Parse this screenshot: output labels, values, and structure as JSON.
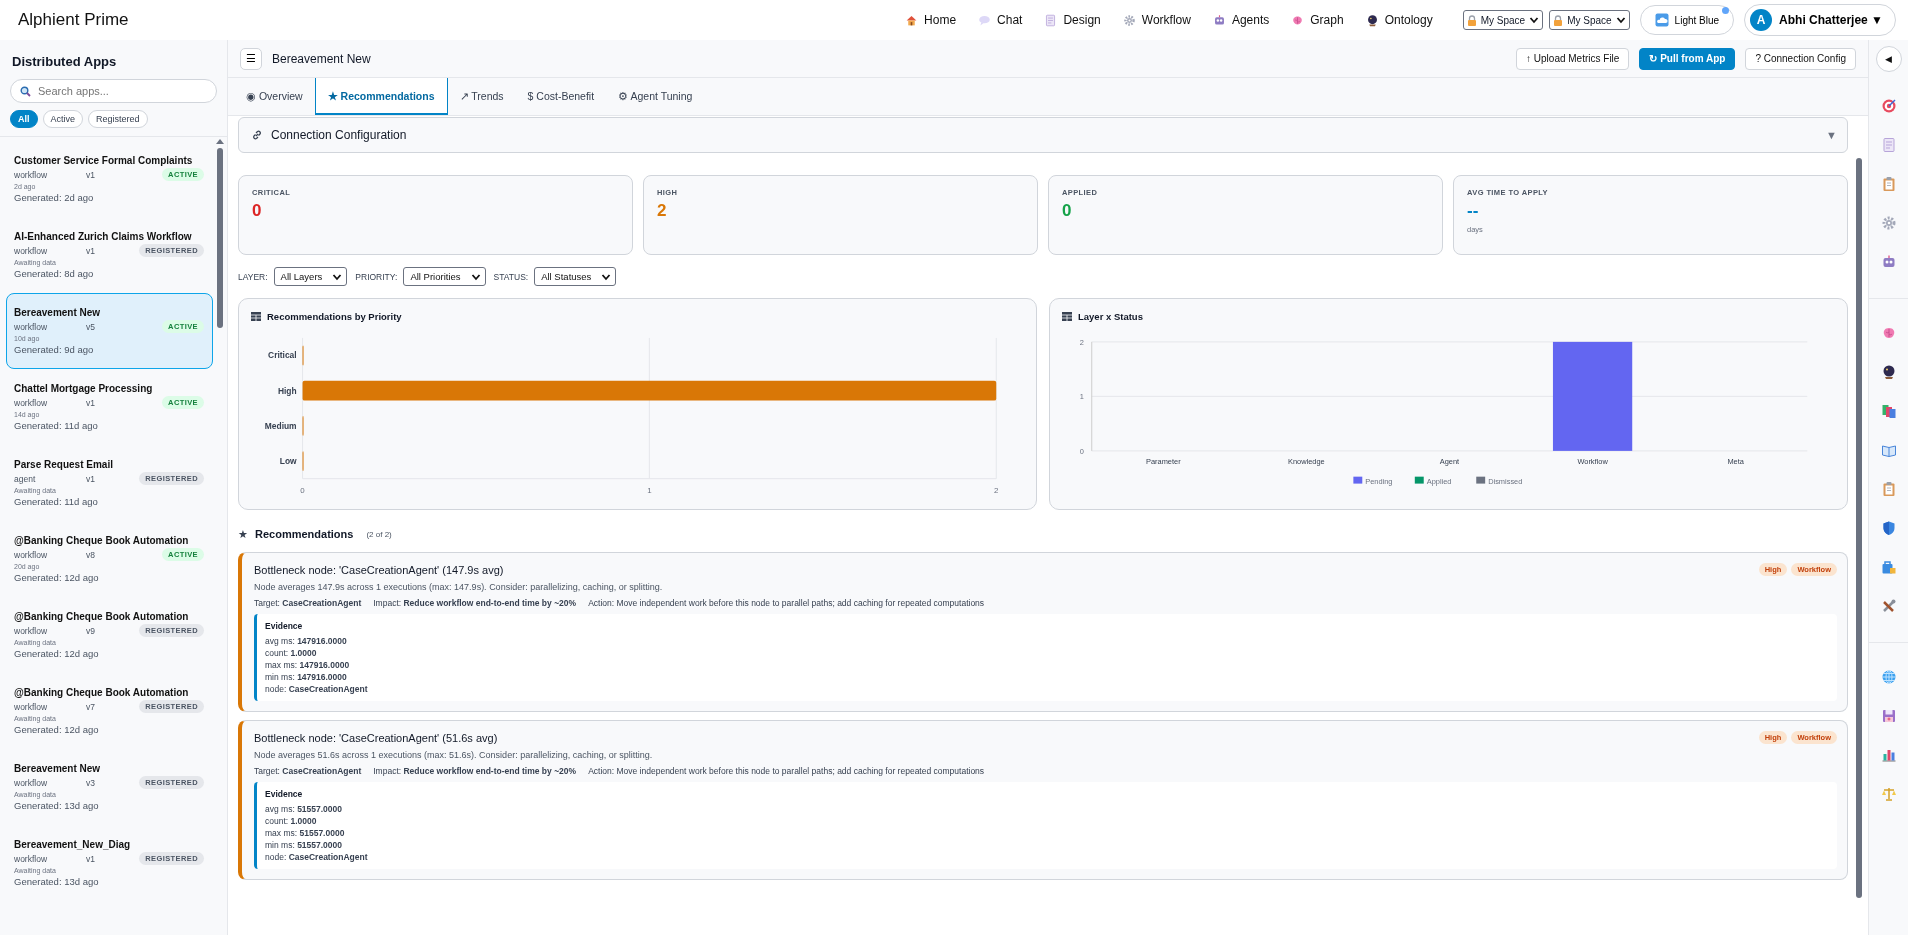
{
  "app": {
    "title": "Alphient Prime"
  },
  "nav": [
    {
      "label": "Home"
    },
    {
      "label": "Chat"
    },
    {
      "label": "Design"
    },
    {
      "label": "Workflow"
    },
    {
      "label": "Agents"
    },
    {
      "label": "Graph"
    },
    {
      "label": "Ontology"
    }
  ],
  "space_selects": [
    {
      "value": "My Space"
    },
    {
      "value": "My Space"
    }
  ],
  "theme_button": {
    "label": "Light Blue"
  },
  "user": {
    "initial": "A",
    "name": "Abhi Chatterjee",
    "caret": "▼"
  },
  "sidebar": {
    "title": "Distributed Apps",
    "search": {
      "placeholder": "Search apps..."
    },
    "filters": [
      {
        "label": "All",
        "selected": true
      },
      {
        "label": "Active",
        "selected": false
      },
      {
        "label": "Registered",
        "selected": false
      }
    ],
    "apps": [
      {
        "name": "Customer Service Formal Complaints",
        "type": "workflow",
        "version": "v1",
        "status": "ACTIVE",
        "kind": "active",
        "age": "2d ago",
        "generated": "Generated: 2d ago",
        "selected": false
      },
      {
        "name": "AI-Enhanced Zurich Claims Workflow",
        "type": "workflow",
        "version": "v1",
        "status": "REGISTERED",
        "kind": "registered",
        "age": "Awaiting data",
        "generated": "Generated: 8d ago",
        "selected": false
      },
      {
        "name": "Bereavement New",
        "type": "workflow",
        "version": "v5",
        "status": "ACTIVE",
        "kind": "active",
        "age": "10d ago",
        "generated": "Generated: 9d ago",
        "selected": true
      },
      {
        "name": "Chattel Mortgage Processing",
        "type": "workflow",
        "version": "v1",
        "status": "ACTIVE",
        "kind": "active",
        "age": "14d ago",
        "generated": "Generated: 11d ago",
        "selected": false
      },
      {
        "name": "Parse Request Email",
        "type": "agent",
        "version": "v1",
        "status": "REGISTERED",
        "kind": "registered",
        "age": "Awaiting data",
        "generated": "Generated: 11d ago",
        "selected": false
      },
      {
        "name": "@Banking Cheque Book Automation",
        "type": "workflow",
        "version": "v8",
        "status": "ACTIVE",
        "kind": "active",
        "age": "20d ago",
        "generated": "Generated: 12d ago",
        "selected": false
      },
      {
        "name": "@Banking Cheque Book Automation",
        "type": "workflow",
        "version": "v9",
        "status": "REGISTERED",
        "kind": "registered",
        "age": "Awaiting data",
        "generated": "Generated: 12d ago",
        "selected": false
      },
      {
        "name": "@Banking Cheque Book Automation",
        "type": "workflow",
        "version": "v7",
        "status": "REGISTERED",
        "kind": "registered",
        "age": "Awaiting data",
        "generated": "Generated: 12d ago",
        "selected": false
      },
      {
        "name": "Bereavement New",
        "type": "workflow",
        "version": "v3",
        "status": "REGISTERED",
        "kind": "registered",
        "age": "Awaiting data",
        "generated": "Generated: 13d ago",
        "selected": false
      },
      {
        "name": "Bereavement_New_Diag",
        "type": "workflow",
        "version": "v1",
        "status": "REGISTERED",
        "kind": "registered",
        "age": "Awaiting data",
        "generated": "Generated: 13d ago",
        "selected": false
      }
    ]
  },
  "header": {
    "menu_icon": "☰",
    "title": "Bereavement New",
    "buttons": [
      {
        "icon": "↑",
        "label": "Upload Metrics File",
        "kind": "secondary"
      },
      {
        "icon": "↻",
        "label": "Pull from App",
        "kind": "primary"
      },
      {
        "icon": "?",
        "label": "Connection Config",
        "kind": "secondary"
      }
    ]
  },
  "tabs": [
    {
      "icon": "◉",
      "label": "Overview",
      "selected": false
    },
    {
      "icon": "★",
      "label": "Recommendations",
      "selected": true
    },
    {
      "icon": "↗",
      "label": "Trends",
      "selected": false
    },
    {
      "icon": "$",
      "label": "Cost-Benefit",
      "selected": false
    },
    {
      "icon": "⚙",
      "label": "Agent Tuning",
      "selected": false
    }
  ],
  "connection": {
    "title": "Connection Configuration",
    "expanded": false,
    "caret": "▼"
  },
  "stats": [
    {
      "label": "CRITICAL",
      "value": "0",
      "color": "#dc2626"
    },
    {
      "label": "HIGH",
      "value": "2",
      "color": "#d97706"
    },
    {
      "label": "APPLIED",
      "value": "0",
      "color": "#16a34a"
    },
    {
      "label": "AVG TIME TO APPLY",
      "value": "--",
      "color": "#0284c7",
      "unit": "days"
    }
  ],
  "filters": [
    {
      "label": "LAYER:",
      "value": "All Layers"
    },
    {
      "label": "PRIORITY:",
      "value": "All Priorities"
    },
    {
      "label": "STATUS:",
      "value": "All Statuses"
    }
  ],
  "charts": [
    {
      "title": "Recommendations by Priority",
      "chart_data": {
        "type": "bar",
        "orientation": "horizontal",
        "categories": [
          "Critical",
          "High",
          "Medium",
          "Low"
        ],
        "series": [
          {
            "color": "#d97706",
            "values": [
              0,
              2,
              0,
              0
            ]
          }
        ],
        "xlim": [
          0,
          2
        ],
        "xticks": [
          0,
          1,
          2
        ]
      }
    },
    {
      "title": "Layer x Status",
      "chart_data": {
        "type": "bar",
        "stacked": true,
        "categories": [
          "Parameter",
          "Knowledge",
          "Agent",
          "Workflow",
          "Meta"
        ],
        "series": [
          {
            "name": "Pending",
            "color": "#6366f1",
            "values": [
              0,
              0,
              0,
              2,
              0
            ]
          },
          {
            "name": "Applied",
            "color": "#059669",
            "values": [
              0,
              0,
              0,
              0,
              0
            ]
          },
          {
            "name": "Dismissed",
            "color": "#6b7280",
            "values": [
              0,
              0,
              0,
              0,
              0
            ]
          }
        ],
        "ylim": [
          0,
          2
        ],
        "yticks": [
          0,
          1,
          2
        ]
      }
    }
  ],
  "recommendations": {
    "icon": "★",
    "title": "Recommendations",
    "count": "(2 of 2)",
    "items": [
      {
        "title": "Bottleneck node: 'CaseCreationAgent' (147.9s avg)",
        "tags": [
          "High",
          "Workflow"
        ],
        "description": "Node averages 147.9s across 1 executions (max: 147.9s). Consider: parallelizing, caching, or splitting.",
        "target": "Target: **CaseCreationAgent**",
        "impact": "Impact: **Reduce workflow end-to-end time by ~20%**",
        "action": "Action: Move independent work before this node to parallel paths; add caching for repeated computations",
        "evidence_title": "Evidence",
        "evidence": [
          "avg ms: **147916.0000**",
          "count: **1.0000**",
          "max ms: **147916.0000**",
          "min ms: **147916.0000**",
          "node: **CaseCreationAgent**"
        ]
      },
      {
        "title": "Bottleneck node: 'CaseCreationAgent' (51.6s avg)",
        "tags": [
          "High",
          "Workflow"
        ],
        "description": "Node averages 51.6s across 1 executions (max: 51.6s). Consider: parallelizing, caching, or splitting.",
        "target": "Target: **CaseCreationAgent**",
        "impact": "Impact: **Reduce workflow end-to-end time by ~20%**",
        "action": "Action: Move independent work before this node to parallel paths; add caching for repeated computations",
        "evidence_title": "Evidence",
        "evidence": [
          "avg ms: **51557.0000**",
          "count: **1.0000**",
          "max ms: **51557.0000**",
          "min ms: **51557.0000**",
          "node: **CaseCreationAgent**"
        ]
      }
    ]
  },
  "rail": {
    "collapse": "◀"
  }
}
